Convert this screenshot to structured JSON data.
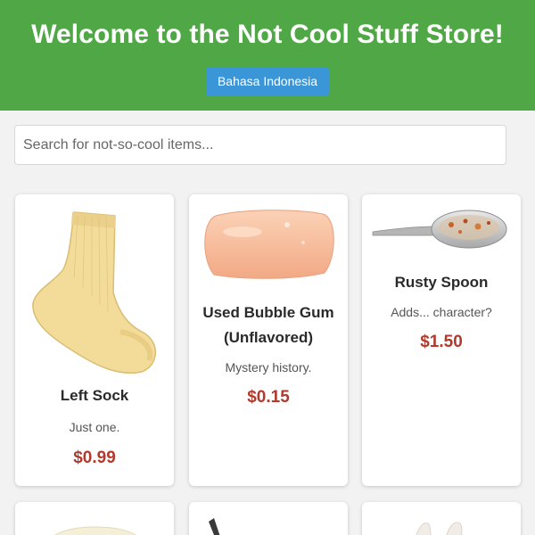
{
  "header": {
    "title": "Welcome to the Not Cool Stuff Store!",
    "language_button": "Bahasa Indonesia",
    "background_color": "#4fa845",
    "button_color": "#3b96d8"
  },
  "search": {
    "placeholder": "Search for not-so-cool items..."
  },
  "products": [
    {
      "name": "Left Sock",
      "description": "Just one.",
      "price": "$0.99",
      "icon": "sock-image"
    },
    {
      "name": "Used Bubble Gum (Unflavored)",
      "description": "Mystery history.",
      "price": "$0.15",
      "icon": "bubble-gum-image"
    },
    {
      "name": "Rusty Spoon",
      "description": "Adds... character?",
      "price": "$1.50",
      "icon": "rusty-spoon-image"
    }
  ],
  "colors": {
    "price": "#b13a2c",
    "page_background": "#f2f2f2"
  }
}
